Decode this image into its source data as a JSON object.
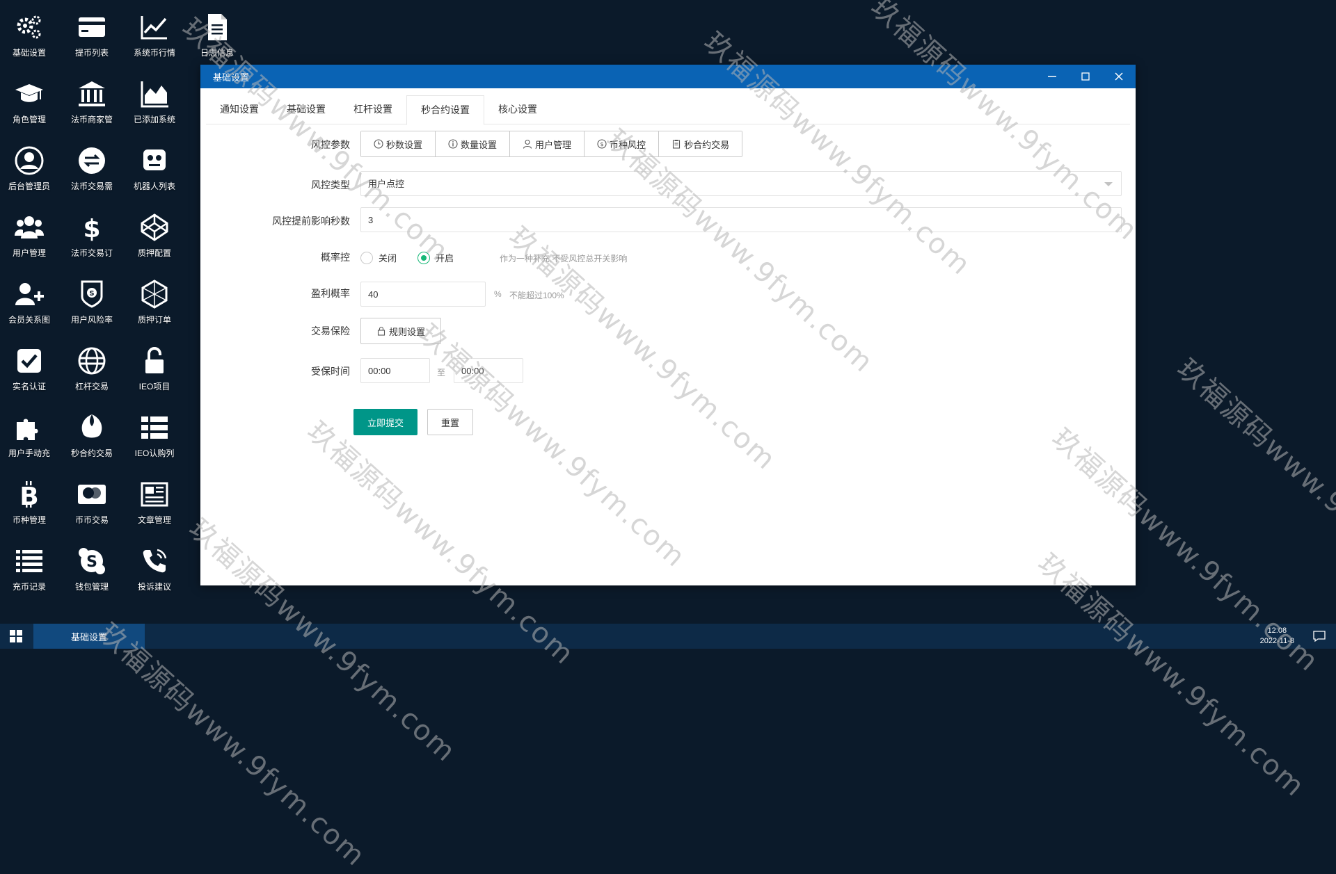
{
  "desktop": {
    "icons": [
      {
        "label": "基础设置",
        "icon": "gears-icon"
      },
      {
        "label": "提币列表",
        "icon": "credit-card-icon"
      },
      {
        "label": "系统币行情",
        "icon": "line-chart-icon"
      },
      {
        "label": "日志信息",
        "icon": "document-icon"
      },
      {
        "label": "角色管理",
        "icon": "graduation-cap-icon"
      },
      {
        "label": "法币商家管",
        "icon": "bank-icon"
      },
      {
        "label": "已添加系统",
        "icon": "area-chart-icon"
      },
      {
        "label": "后台管理员",
        "icon": "user-circle-icon"
      },
      {
        "label": "法币交易需",
        "icon": "exchange-icon"
      },
      {
        "label": "机器人列表",
        "icon": "robot-icon"
      },
      {
        "label": "用户管理",
        "icon": "users-icon"
      },
      {
        "label": "法币交易订",
        "icon": "dollar-icon"
      },
      {
        "label": "质押配置",
        "icon": "codepen-icon"
      },
      {
        "label": "会员关系图",
        "icon": "user-plus-icon"
      },
      {
        "label": "用户风险率",
        "icon": "shield-icon"
      },
      {
        "label": "质押订单",
        "icon": "hexagon-icon"
      },
      {
        "label": "实名认证",
        "icon": "check-square-icon"
      },
      {
        "label": "杠杆交易",
        "icon": "globe-icon"
      },
      {
        "label": "IEO项目",
        "icon": "unlock-icon"
      },
      {
        "label": "用户手动充",
        "icon": "puzzle-icon"
      },
      {
        "label": "秒合约交易",
        "icon": "rebel-icon"
      },
      {
        "label": "IEO认购列",
        "icon": "list-icon"
      },
      {
        "label": "币种管理",
        "icon": "bitcoin-icon"
      },
      {
        "label": "币币交易",
        "icon": "mastercard-icon"
      },
      {
        "label": "文章管理",
        "icon": "newspaper-icon"
      },
      {
        "label": "充币记录",
        "icon": "list-ul-icon"
      },
      {
        "label": "钱包管理",
        "icon": "skype-icon"
      },
      {
        "label": "投诉建议",
        "icon": "phone-icon"
      }
    ]
  },
  "window": {
    "title": "基础设置",
    "tabs": [
      "通知设置",
      "基础设置",
      "杠杆设置",
      "秒合约设置",
      "核心设置"
    ],
    "active_tab": 3,
    "form": {
      "risk_params": {
        "label": "风控参数",
        "buttons": [
          {
            "label": "秒数设置",
            "icon": "clock-icon"
          },
          {
            "label": "数量设置",
            "icon": "info-icon"
          },
          {
            "label": "用户管理",
            "icon": "user-icon"
          },
          {
            "label": "币种风控",
            "icon": "dollar-circle-icon"
          },
          {
            "label": "秒合约交易",
            "icon": "clipboard-icon"
          }
        ]
      },
      "risk_type": {
        "label": "风控类型",
        "value": "用户点控"
      },
      "advance_seconds": {
        "label": "风控提前影响秒数",
        "value": "3"
      },
      "probability": {
        "label": "概率控",
        "options": [
          "关闭",
          "开启"
        ],
        "selected": 1,
        "hint": "作为一种补充,不受风控总开关影响"
      },
      "profit_rate": {
        "label": "盈利概率",
        "value": "40",
        "unit": "%",
        "hint": "不能超过100%"
      },
      "insurance": {
        "label": "交易保险",
        "button": "规则设置"
      },
      "insured_time": {
        "label": "受保时间",
        "start": "00:00",
        "separator": "至",
        "end": "00:00"
      },
      "submit": "立即提交",
      "reset": "重置"
    }
  },
  "taskbar": {
    "task": "基础设置",
    "time": "12:08",
    "date": "2022-11-8"
  },
  "watermark": "玖福源码www.9fym.com"
}
